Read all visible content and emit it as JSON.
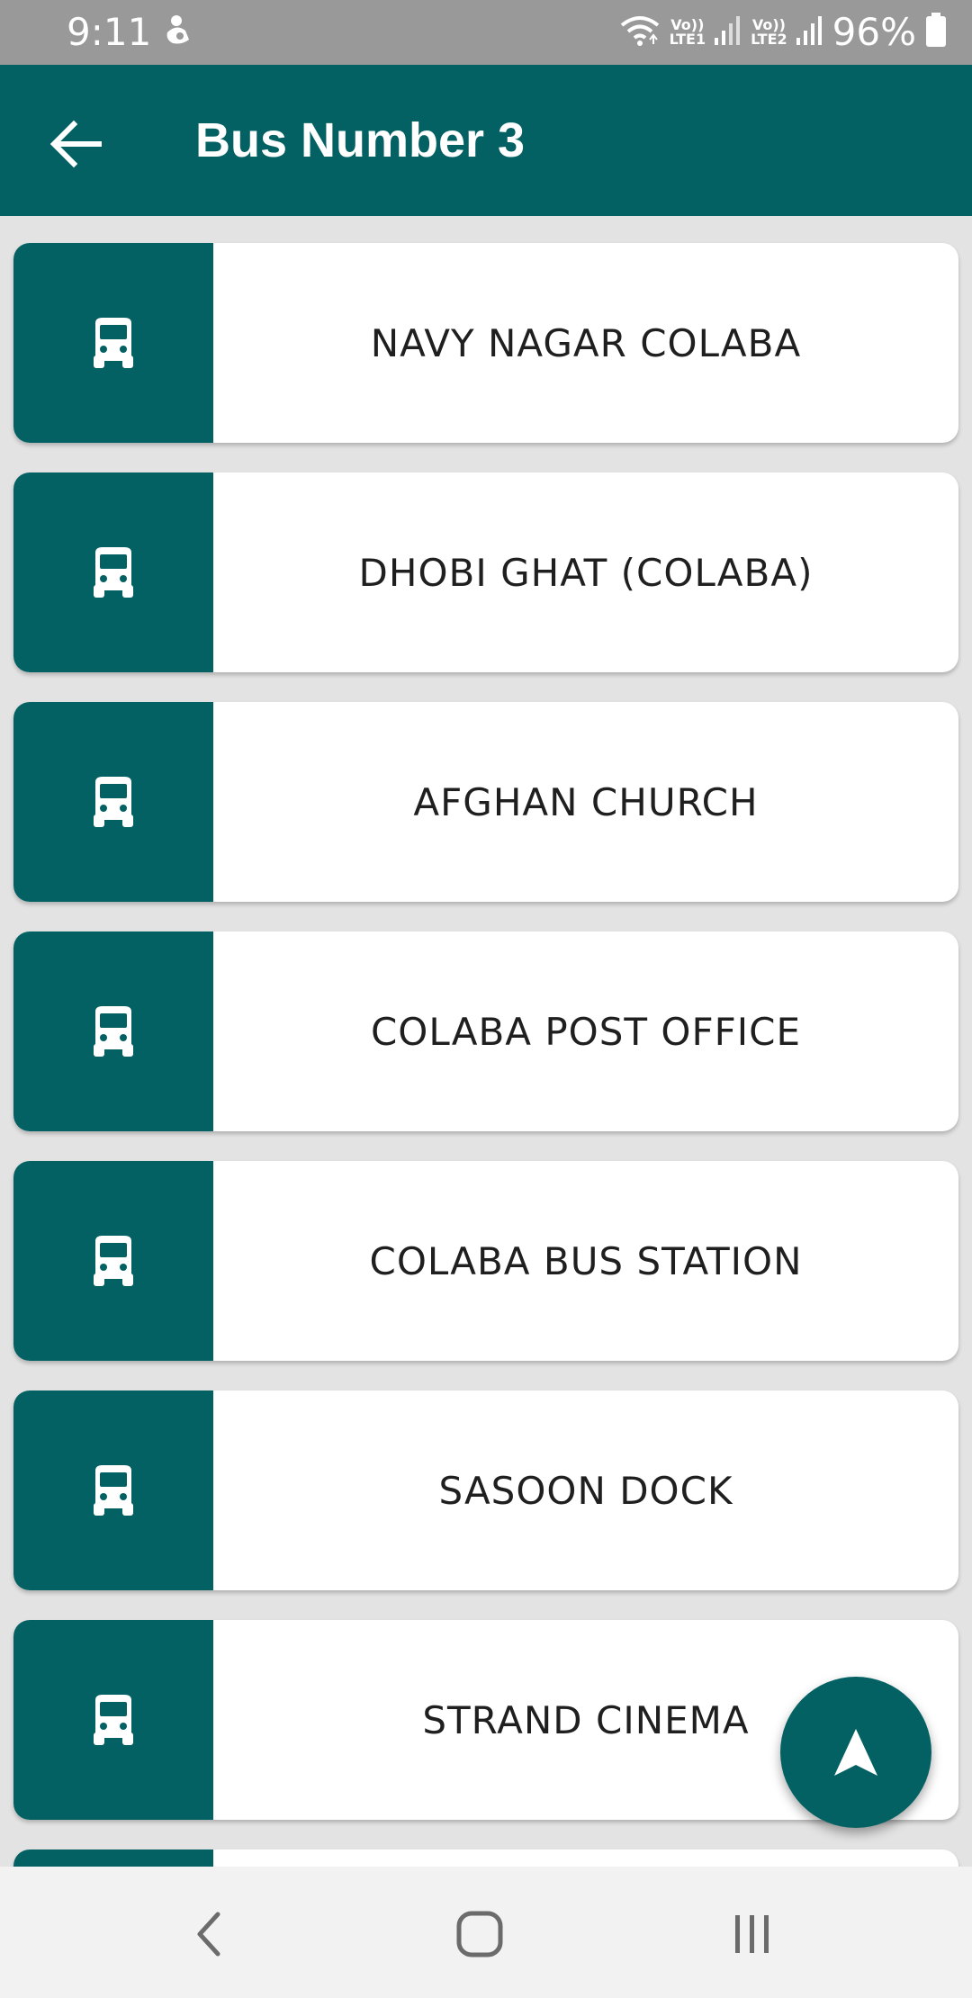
{
  "status_bar": {
    "time": "9:11",
    "battery": "96%",
    "sim1": "LTE1",
    "sim2": "LTE2",
    "volte": "Vo))",
    "icons": [
      "wifi-icon",
      "signal-icon",
      "battery-icon",
      "assistant-icon"
    ]
  },
  "header": {
    "title": "Bus Number 3",
    "back_icon": "arrow-left-icon"
  },
  "stops": [
    {
      "name": "NAVY NAGAR COLABA",
      "icon": "bus-icon"
    },
    {
      "name": "DHOBI GHAT (COLABA)",
      "icon": "bus-icon"
    },
    {
      "name": "AFGHAN CHURCH",
      "icon": "bus-icon"
    },
    {
      "name": "COLABA POST OFFICE",
      "icon": "bus-icon"
    },
    {
      "name": "COLABA BUS STATION",
      "icon": "bus-icon"
    },
    {
      "name": "SASOON DOCK",
      "icon": "bus-icon"
    },
    {
      "name": "STRAND CINEMA",
      "icon": "bus-icon"
    },
    {
      "name": "",
      "icon": "bus-icon"
    }
  ],
  "fab": {
    "icon": "navigation-arrow-icon"
  },
  "nav_bar": {
    "icons": [
      "back-icon",
      "home-icon",
      "recents-icon"
    ]
  },
  "colors": {
    "primary": "#036163",
    "status_bar": "#999999",
    "background": "#e3e3e3",
    "card": "#ffffff",
    "text": "#1f1f1f"
  }
}
